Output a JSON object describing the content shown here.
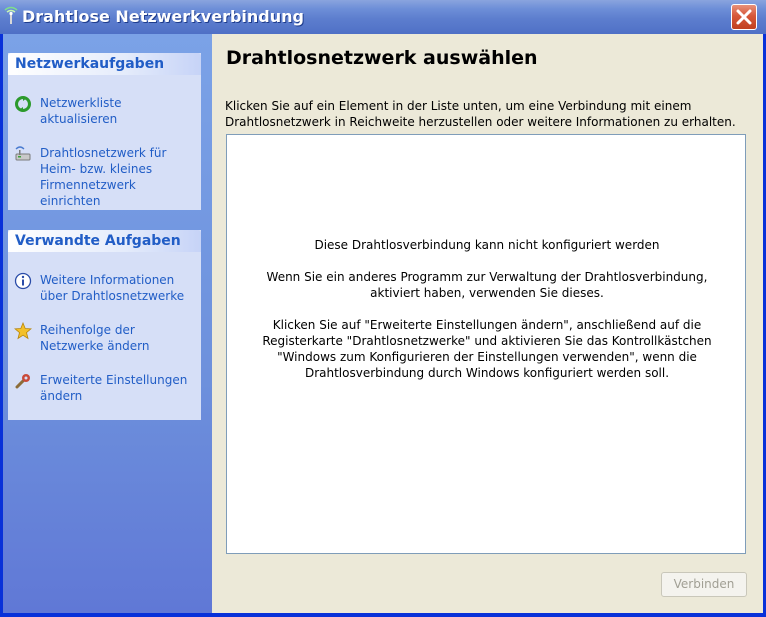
{
  "window": {
    "title": "Drahtlose Netzwerkverbindung",
    "close_icon": "close-icon"
  },
  "sidebar": {
    "network_tasks": {
      "header": "Netzwerkaufgaben",
      "items": [
        {
          "label": "Netzwerkliste aktualisieren",
          "icon": "refresh-icon"
        },
        {
          "label": "Drahtlosnetzwerk für Heim- bzw. kleines Firmennetzwerk einrichten",
          "icon": "wireless-setup-icon"
        }
      ]
    },
    "related_tasks": {
      "header": "Verwandte Aufgaben",
      "items": [
        {
          "label": "Weitere Informationen über Drahtlosnetzwerke",
          "icon": "info-icon"
        },
        {
          "label": "Reihenfolge der Netzwerke ändern",
          "icon": "star-icon"
        },
        {
          "label": "Erweiterte Einstellungen ändern",
          "icon": "settings-icon"
        }
      ]
    }
  },
  "main": {
    "heading": "Drahtlosnetzwerk auswählen",
    "intro": "Klicken Sie auf ein Element in der Liste unten, um eine Verbindung mit einem Drahtlosnetzwerk in Reichweite herzustellen oder weitere Informationen zu erhalten.",
    "messages": {
      "line1": "Diese Drahtlosverbindung kann nicht konfiguriert werden",
      "line2": "Wenn Sie ein anderes Programm zur Verwaltung der Drahtlosverbindung, aktiviert haben, verwenden Sie dieses.",
      "line3": "Klicken Sie auf \"Erweiterte Einstellungen ändern\", anschließend auf die Registerkarte \"Drahtlosnetzwerke\" und aktivieren Sie das Kontrollkästchen \"Windows zum Konfigurieren der Einstellungen verwenden\", wenn die Drahtlosverbindung durch Windows konfiguriert werden soll."
    },
    "connect_button": "Verbinden"
  },
  "colors": {
    "title_bar": "#5d7ece",
    "sidebar": "#6d90dc",
    "link": "#215dc6",
    "client": "#ece9d8",
    "close_button": "#d6583a"
  }
}
